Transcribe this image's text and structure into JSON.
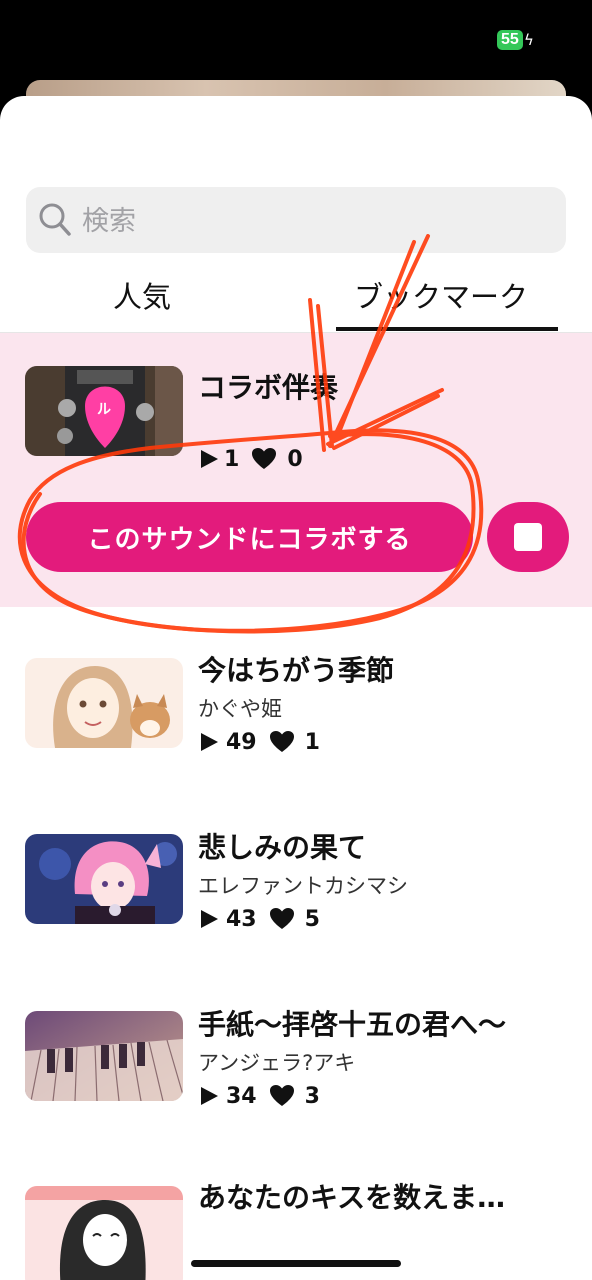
{
  "status_bar": {
    "battery": "55"
  },
  "search": {
    "placeholder": "検索"
  },
  "tabs": [
    {
      "label": "人気",
      "selected": false
    },
    {
      "label": "ブックマーク",
      "selected": true
    }
  ],
  "active_item": {
    "title": "コラボ伴奏",
    "plays": "1",
    "likes": "0",
    "collab_button": "このサウンドにコラボする"
  },
  "items": [
    {
      "title": "今はちがう季節",
      "artist": "かぐや姫",
      "plays": "49",
      "likes": "1"
    },
    {
      "title": "悲しみの果て",
      "artist": "エレファントカシマシ",
      "plays": "43",
      "likes": "5"
    },
    {
      "title": "手紙～拝啓十五の君へ～",
      "artist": "アンジェラ?アキ",
      "plays": "34",
      "likes": "3"
    },
    {
      "title": "あなたのキスを数えま…",
      "artist": ""
    }
  ],
  "colors": {
    "accent": "#e31b7c",
    "active_row_bg": "#fbe5ee",
    "annotation": "#ff3a0a"
  }
}
